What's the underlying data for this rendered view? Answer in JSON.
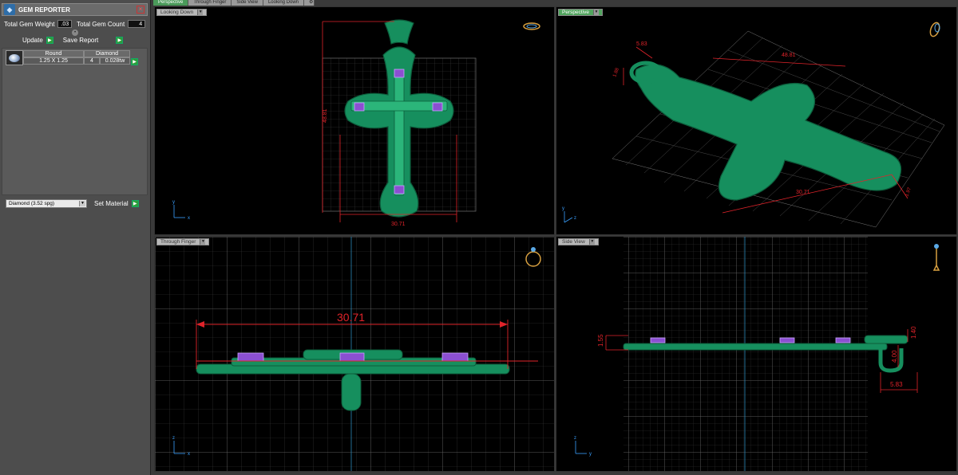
{
  "panel": {
    "title": "GEM REPORTER",
    "total_weight_label": "Total Gem Weight",
    "total_weight_value": ".03",
    "total_count_label": "Total Gem Count",
    "total_count_value": "4",
    "update_label": "Update",
    "save_report_label": "Save Report",
    "gem_headers": [
      "Round",
      "Diamond"
    ],
    "gem_row": {
      "size": "1.25 X 1.25",
      "count": "4",
      "weight": "0.028tw"
    },
    "material_value": "Diamond     (3.52 spg)",
    "set_material_label": "Set Material"
  },
  "tabs": [
    "Perspective",
    "Through Finger",
    "Side View",
    "Looking Down"
  ],
  "viewports": {
    "top_left": {
      "label": "Looking Down",
      "dim_width": "30.71",
      "dim_height": "48.81"
    },
    "top_right": {
      "label": "Perspective",
      "dim_a": "5.83",
      "dim_b": "48.81",
      "dim_c": "30.71",
      "dim_d": "1.88",
      "dim_e": "1.97"
    },
    "bottom_left": {
      "label": "Through Finger",
      "dim_width": "30.71"
    },
    "bottom_right": {
      "label": "Side View",
      "dim_height": "1.55",
      "dim_loop": "4.00",
      "dim_top": "1.40",
      "dim_bottom": "5.83"
    }
  },
  "axes": {
    "x": "x",
    "y": "y",
    "z": "z"
  },
  "colors": {
    "model": "#1a9e6a",
    "dimension": "#e0232a",
    "gem": "#9a4fd6",
    "grid": "#4a4a4a"
  }
}
